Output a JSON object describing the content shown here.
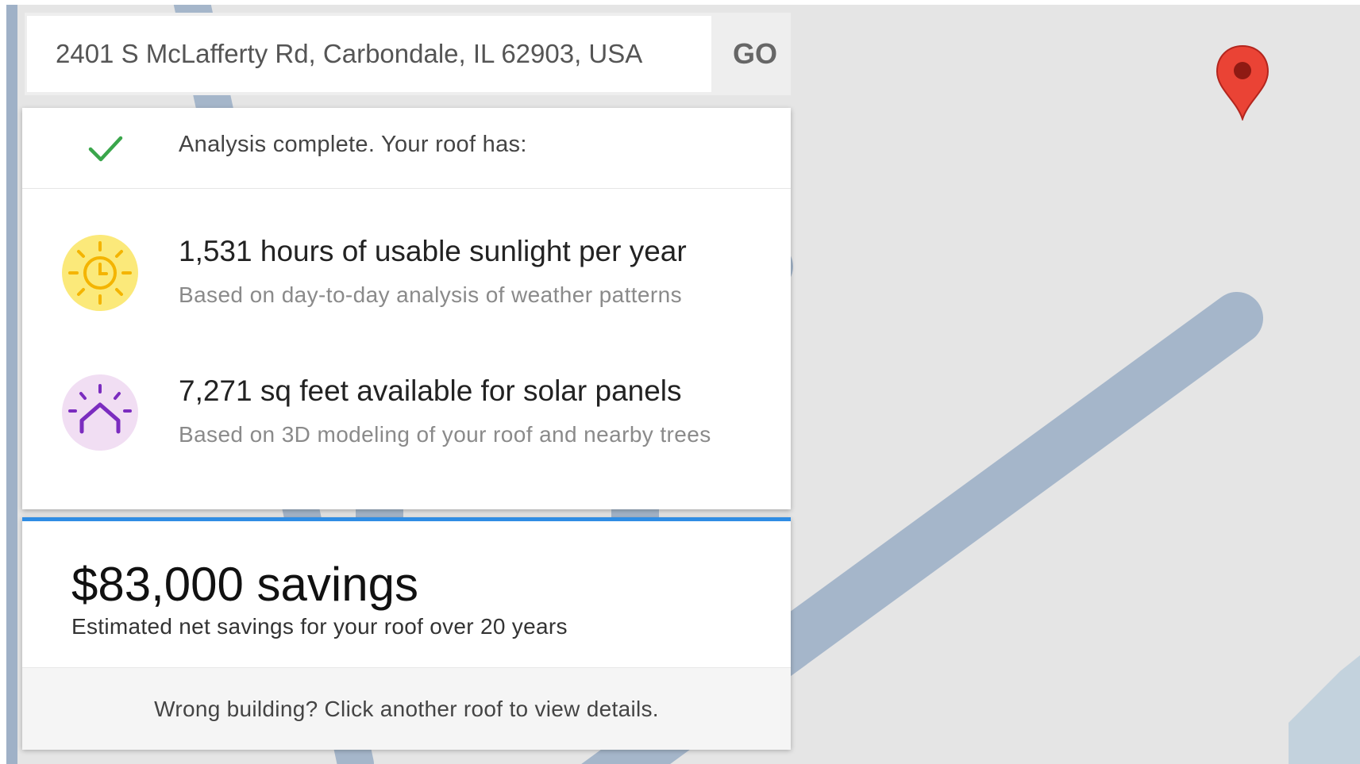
{
  "search": {
    "value": "2401 S McLafferty Rd, Carbondale, IL 62903, USA",
    "placeholder": "",
    "go_label": "GO"
  },
  "analysis": {
    "status_icon": "check-icon",
    "header": "Analysis complete. Your roof has:",
    "stats": [
      {
        "icon": "sun-clock-icon",
        "title": "1,531 hours of usable sunlight per year",
        "subtitle": "Based on day-to-day analysis of weather patterns"
      },
      {
        "icon": "house-rays-icon",
        "title": "7,271 sq feet available for solar panels",
        "subtitle": "Based on 3D modeling of your roof and nearby trees"
      }
    ]
  },
  "savings": {
    "amount": "$83,000 savings",
    "subtitle": "Estimated net savings for your roof over 20 years",
    "footer": "Wrong building? Click another roof to view details."
  },
  "map": {
    "marker_icon": "map-pin-icon"
  },
  "colors": {
    "accent_blue": "#2f8de4",
    "check_green": "#3aa64b",
    "sun_bg": "#fbe97a",
    "sun_fg": "#f4b400",
    "roof_bg": "#f1def3",
    "roof_fg": "#7b2cbf",
    "marker_red": "#ea4335",
    "road": "#a5b6ca",
    "map_bg": "#e5e5e5"
  }
}
